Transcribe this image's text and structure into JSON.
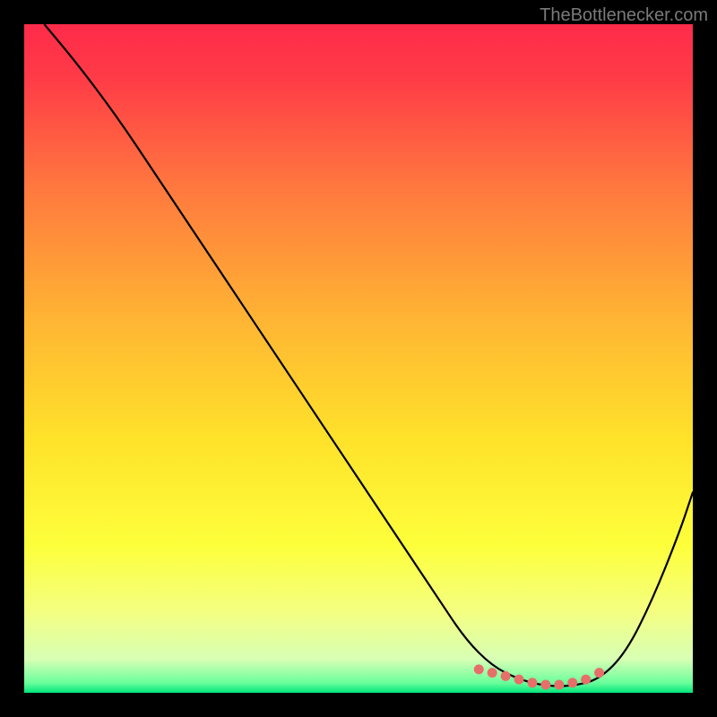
{
  "watermark": "TheBottlenecker.com",
  "chart_data": {
    "type": "line",
    "title": "",
    "xlabel": "",
    "ylabel": "",
    "xlim": [
      0,
      100
    ],
    "ylim": [
      0,
      100
    ],
    "gradient_stops": [
      {
        "pos": 0.0,
        "color": "#ff2b4a"
      },
      {
        "pos": 0.08,
        "color": "#ff3b47"
      },
      {
        "pos": 0.25,
        "color": "#ff7a3e"
      },
      {
        "pos": 0.45,
        "color": "#ffb733"
      },
      {
        "pos": 0.62,
        "color": "#ffe22a"
      },
      {
        "pos": 0.78,
        "color": "#fdff3b"
      },
      {
        "pos": 0.88,
        "color": "#f4ff82"
      },
      {
        "pos": 0.95,
        "color": "#d7ffb5"
      },
      {
        "pos": 0.985,
        "color": "#6bff9c"
      },
      {
        "pos": 1.0,
        "color": "#00e47a"
      }
    ],
    "series": [
      {
        "name": "bottleneck-curve",
        "x": [
          3,
          8,
          14,
          20,
          26,
          32,
          38,
          44,
          50,
          56,
          62,
          66,
          70,
          74,
          78,
          82,
          86,
          90,
          94,
          98,
          100
        ],
        "y": [
          100,
          94,
          86,
          77,
          68,
          59,
          50,
          41,
          32,
          23,
          14,
          8,
          4,
          2,
          1,
          1,
          2,
          6,
          14,
          24,
          30
        ]
      }
    ],
    "markers": {
      "name": "optimal-range",
      "color": "#e76f6a",
      "x": [
        68,
        70,
        72,
        74,
        76,
        78,
        80,
        82,
        84,
        86
      ],
      "y": [
        3.5,
        3.0,
        2.5,
        2.0,
        1.5,
        1.2,
        1.2,
        1.5,
        2.0,
        3.0
      ]
    }
  }
}
